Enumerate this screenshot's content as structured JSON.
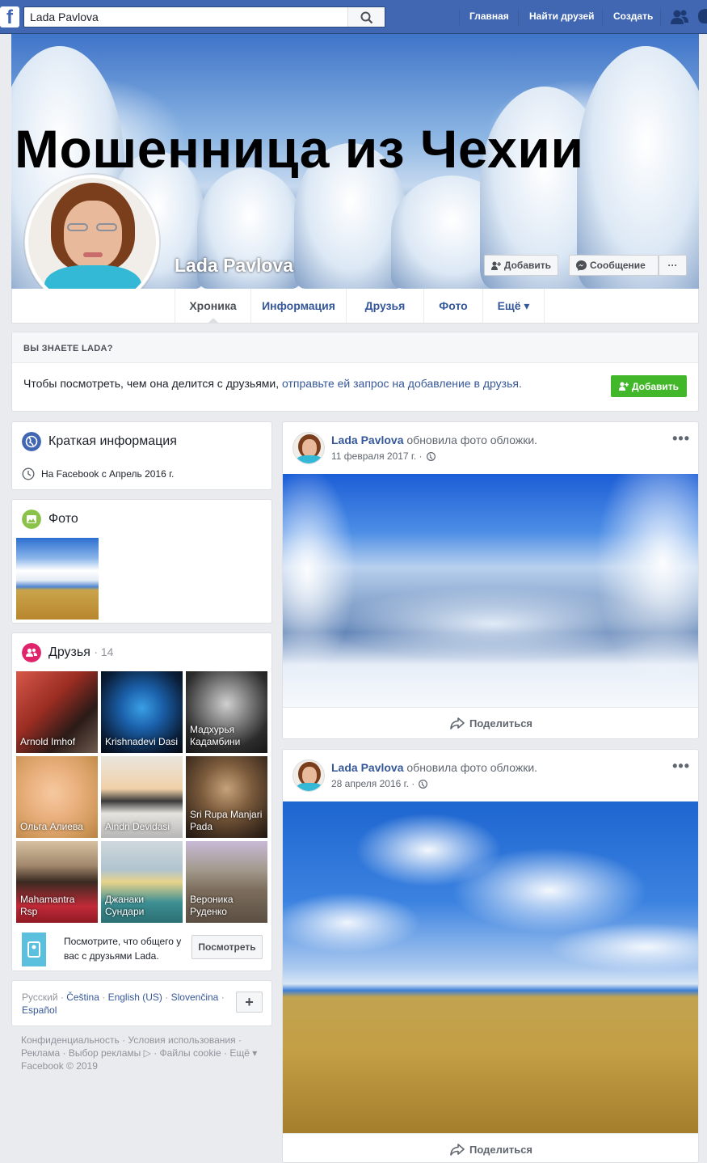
{
  "topbar": {
    "search_value": "Lada Pavlova",
    "nav": [
      "Главная",
      "Найти друзей",
      "Создать"
    ]
  },
  "cover": {
    "title": "Мошенница из Чехии",
    "name": "Lada Pavlova",
    "add_button": "Добавить",
    "message_button": "Сообщение",
    "more_button": "···"
  },
  "tabs": [
    "Хроника",
    "Информация",
    "Друзья",
    "Фото",
    "Ещё ▾"
  ],
  "know": {
    "heading": "ВЫ ЗНАЕТЕ LADA?",
    "text": "Чтобы посмотреть, чем она делится с друзьями, ",
    "link": "отправьте ей запрос на добавление в друзья.",
    "button": "Добавить"
  },
  "intro": {
    "title": "Краткая информация",
    "since": "На Facebook с Апрель 2016 г."
  },
  "photos": {
    "title": "Фото"
  },
  "friends": {
    "title": "Друзья",
    "count": "· 14",
    "items": [
      "Arnold Imhof",
      "Krishnadevi Dasi",
      "Мадхурья Кадамбини",
      "Ольга Алиева",
      "Aindri Devidasi",
      "Sri Rupa Manjari Pada",
      "Mahamantra Rsp",
      "Джанаки Сундари",
      "Вероника Руденко"
    ],
    "mutual_text": "Посмотрите, что общего у вас с друзьями Lada.",
    "mutual_button": "Посмотреть"
  },
  "languages": {
    "current": "Русский ·",
    "links": [
      "Čeština",
      "English (US)",
      "Slovenčina",
      "Español"
    ],
    "plus": "+"
  },
  "footer": {
    "line1": [
      "Конфиденциальность",
      "Условия использования"
    ],
    "line2": [
      "Реклама",
      "Выбор рекламы",
      "Файлы cookie",
      "Ещё ▾"
    ],
    "copyright": "Facebook © 2019"
  },
  "posts": [
    {
      "name": "Lada Pavlova",
      "action": "обновила фото обложки.",
      "date": "11 февраля 2017 г. ·",
      "share": "Поделиться"
    },
    {
      "name": "Lada Pavlova",
      "action": "обновила фото обложки.",
      "date": "28 апреля 2016 г. ·",
      "share": "Поделиться"
    }
  ],
  "colors": {
    "brand": "#4267b2",
    "link": "#365899",
    "green": "#42b72a",
    "background": "#e9ebee"
  }
}
